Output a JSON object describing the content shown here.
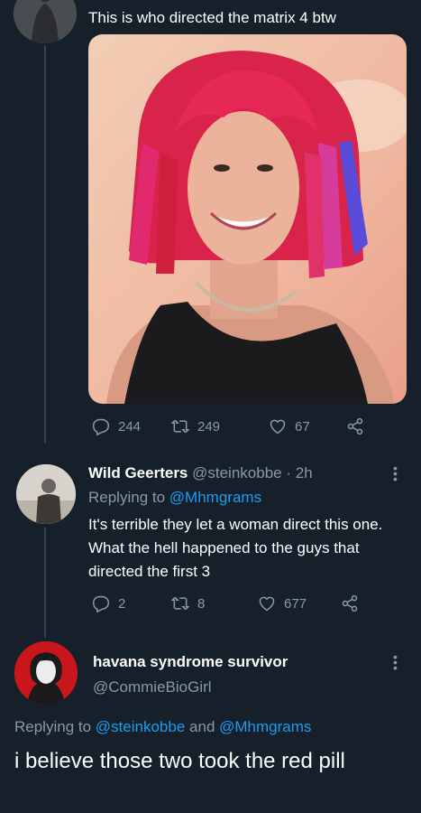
{
  "tweet1": {
    "text": "This is who directed the matrix 4 btw",
    "stats": {
      "replies": "244",
      "retweets": "249",
      "likes": "67"
    }
  },
  "tweet2": {
    "display_name": "Wild Geerters",
    "handle": "@steinkobbe",
    "separator": "·",
    "time": "2h",
    "replying_prefix": "Replying to",
    "replying_to": "@Mhmgrams",
    "text": "It's terrible they let a woman direct this one. What the hell happened to the guys that directed the first 3",
    "stats": {
      "replies": "2",
      "retweets": "8",
      "likes": "677"
    }
  },
  "tweet3": {
    "display_name": "havana syndrome survivor",
    "handle": "@CommieBioGirl",
    "replying_prefix": "Replying to",
    "replying_to_1": "@steinkobbe",
    "replying_and": "and",
    "replying_to_2": "@Mhmgrams",
    "text": "i believe those two took the red pill"
  },
  "icons": {
    "reply": "reply-icon",
    "retweet": "retweet-icon",
    "like": "heart-icon",
    "share": "share-icon",
    "more": "more-dots-icon"
  },
  "colors": {
    "background": "#15202b",
    "muted": "#8b98a5",
    "link": "#1d9bf0",
    "line": "#38444d"
  }
}
